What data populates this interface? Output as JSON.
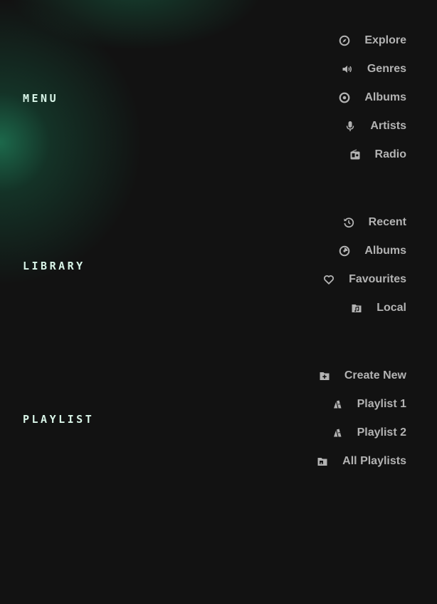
{
  "menu": {
    "title": "MENU",
    "items": [
      {
        "label": "Explore",
        "icon": "compass-icon"
      },
      {
        "label": "Genres",
        "icon": "speaker-icon"
      },
      {
        "label": "Albums",
        "icon": "disc-icon"
      },
      {
        "label": "Artists",
        "icon": "microphone-icon"
      },
      {
        "label": "Radio",
        "icon": "radio-icon"
      }
    ]
  },
  "library": {
    "title": "LIBRARY",
    "items": [
      {
        "label": "Recent",
        "icon": "history-icon"
      },
      {
        "label": "Albums",
        "icon": "record-icon"
      },
      {
        "label": "Favourites",
        "icon": "heart-icon"
      },
      {
        "label": "Local",
        "icon": "music-folder-icon"
      }
    ]
  },
  "playlist": {
    "title": "PLAYLIST",
    "items": [
      {
        "label": "Create New",
        "icon": "folder-plus-icon"
      },
      {
        "label": "Playlist 1",
        "icon": "playlist-icon"
      },
      {
        "label": "Playlist 2",
        "icon": "playlist-icon"
      },
      {
        "label": "All Playlists",
        "icon": "folder-image-icon"
      }
    ]
  },
  "colors": {
    "background": "#121212",
    "section_title": "#d9f5e8",
    "item_text": "#b3b3b3",
    "glow": "#1e7855"
  }
}
